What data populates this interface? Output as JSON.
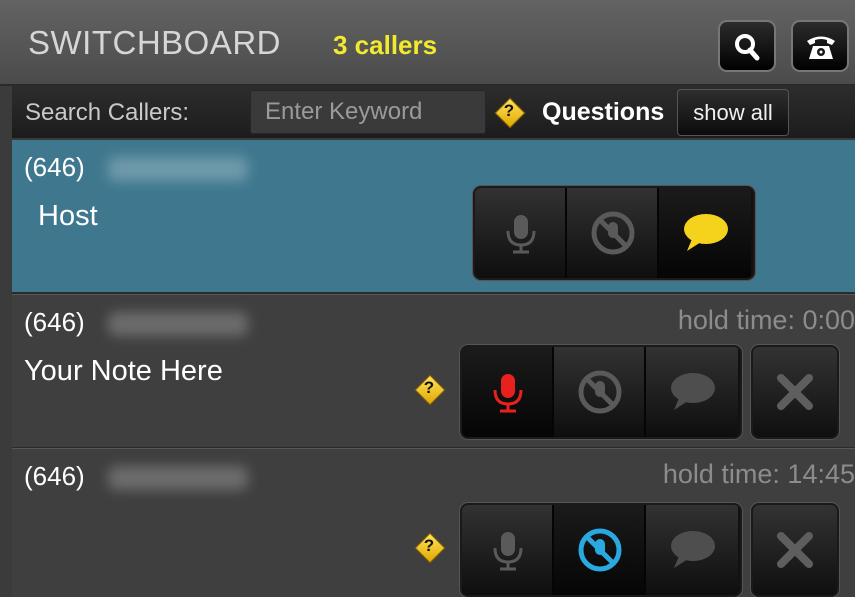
{
  "header": {
    "title": "SWITCHBOARD",
    "caller_count": "3 callers",
    "search_icon": "magnifier-icon",
    "phone_icon": "telephone-icon"
  },
  "search": {
    "label": "Search Callers:",
    "placeholder": "Enter Keyword",
    "questions_label": "Questions",
    "questions_icon": "question-diamond-icon",
    "show_all_label": "show all"
  },
  "callers": [
    {
      "phone_prefix": "(646)",
      "note": "Host",
      "hold_time": "",
      "controls": {
        "mic": "off",
        "mute": "off",
        "chat": "active"
      }
    },
    {
      "phone_prefix": "(646)",
      "note": "Your Note Here",
      "hold_time": "hold time: 0:00",
      "controls": {
        "mic": "active",
        "mute": "off",
        "chat": "off"
      }
    },
    {
      "phone_prefix": "(646)",
      "note": "",
      "hold_time": "hold time: 14:45",
      "controls": {
        "mic": "off",
        "mute": "active",
        "chat": "off"
      }
    }
  ],
  "colors": {
    "caller_count": "#f2ea2c",
    "host_row": "#3f788e",
    "chat_active": "#f5d21c",
    "mic_active": "#e8201e",
    "mute_active": "#2aa8e0",
    "question_icon": "#f2c20a"
  }
}
